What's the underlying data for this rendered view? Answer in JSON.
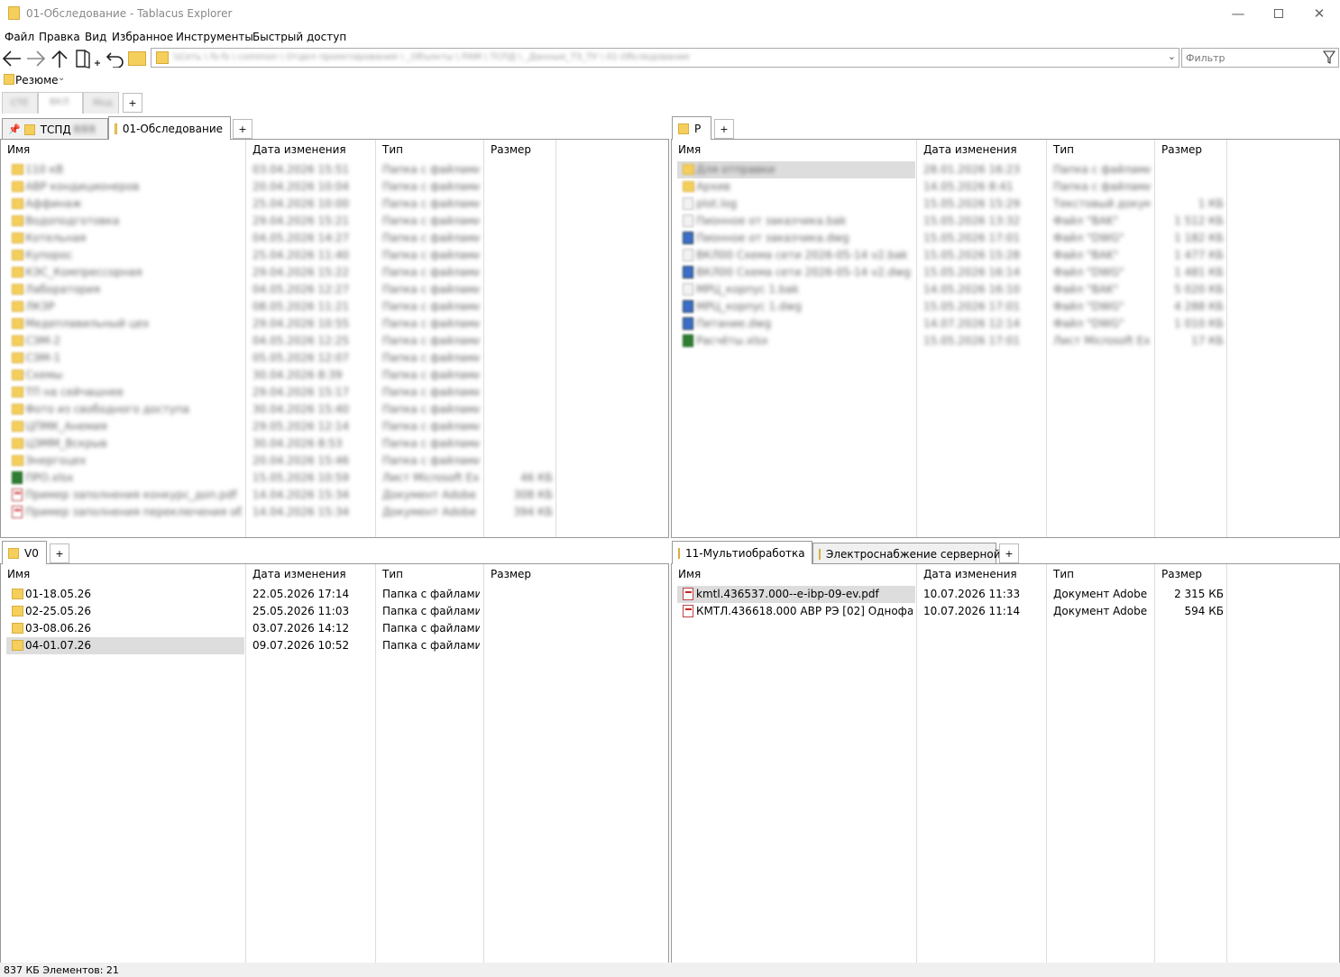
{
  "window": {
    "title": "01-Обследование - Tablacus Explorer"
  },
  "menu": [
    "Файл",
    "Правка",
    "Вид",
    "Избранное",
    "Инструменты",
    "Быстрый доступ"
  ],
  "address": {
    "path": "\\\\Сеть \\ fs-fs \\ common \\ Отдел проектирования \\ _Объекты \\ РАМ \\ ТСПД \\ _Данные_ТЗ_ТУ \\ 01-Обследование"
  },
  "filter": {
    "placeholder": "Фильтр"
  },
  "favorites": {
    "label": "Резюме"
  },
  "group_tabs": [
    "СТЕ",
    "ВКЛ",
    "Мод"
  ],
  "columns": {
    "name": "Имя",
    "date": "Дата изменения",
    "type": "Тип",
    "size": "Размер"
  },
  "panes": {
    "top_left": {
      "tabs": [
        "ТСПД",
        "01-Обследование"
      ],
      "tab_blur_suffix": "ЯЯЯ",
      "rows": [
        {
          "name": "110 кВ",
          "date": "03.04.2026 15:51",
          "type": "Папка с файлами",
          "size": "",
          "icon": "folder"
        },
        {
          "name": "АВР кондиционеров",
          "date": "20.04.2026 10:04",
          "type": "Папка с файлами",
          "size": "",
          "icon": "folder"
        },
        {
          "name": "Аффинаж",
          "date": "25.04.2026 10:00",
          "type": "Папка с файлами",
          "size": "",
          "icon": "folder"
        },
        {
          "name": "Водоподготовка",
          "date": "29.04.2026 15:21",
          "type": "Папка с файлами",
          "size": "",
          "icon": "folder"
        },
        {
          "name": "Котельная",
          "date": "04.05.2026 14:27",
          "type": "Папка с файлами",
          "size": "",
          "icon": "folder"
        },
        {
          "name": "Купорос",
          "date": "25.04.2026 11:40",
          "type": "Папка с файлами",
          "size": "",
          "icon": "folder"
        },
        {
          "name": "КЭС_Компрессорная",
          "date": "29.04.2026 15:22",
          "type": "Папка с файлами",
          "size": "",
          "icon": "folder"
        },
        {
          "name": "Лаборатория",
          "date": "04.05.2026 12:27",
          "type": "Папка с файлами",
          "size": "",
          "icon": "folder"
        },
        {
          "name": "ЛКЗР",
          "date": "08.05.2026 11:21",
          "type": "Папка с файлами",
          "size": "",
          "icon": "folder"
        },
        {
          "name": "Медеплавильный цех",
          "date": "29.04.2026 10:55",
          "type": "Папка с файлами",
          "size": "",
          "icon": "folder"
        },
        {
          "name": "СЭМ-2",
          "date": "04.05.2026 12:25",
          "type": "Папка с файлами",
          "size": "",
          "icon": "folder"
        },
        {
          "name": "СЭМ-1",
          "date": "05.05.2026 12:07",
          "type": "Папка с файлами",
          "size": "",
          "icon": "folder"
        },
        {
          "name": "Схемы",
          "date": "30.04.2026 8:39",
          "type": "Папка с файлами",
          "size": "",
          "icon": "folder"
        },
        {
          "name": "ТП на сейчашнее",
          "date": "29.04.2026 15:17",
          "type": "Папка с файлами",
          "size": "",
          "icon": "folder"
        },
        {
          "name": "Фото из свободного доступа",
          "date": "30.04.2026 15:40",
          "type": "Папка с файлами",
          "size": "",
          "icon": "folder"
        },
        {
          "name": "ЦПМК_Анемия",
          "date": "29.05.2026 12:14",
          "type": "Папка с файлами",
          "size": "",
          "icon": "folder"
        },
        {
          "name": "ЦЭММ_Вскрыв",
          "date": "30.04.2026 8:53",
          "type": "Папка с файлами",
          "size": "",
          "icon": "folder"
        },
        {
          "name": "Энергоцех",
          "date": "20.04.2026 15:46",
          "type": "Папка с файлами",
          "size": "",
          "icon": "folder"
        },
        {
          "name": "ПРО.xlsx",
          "date": "15.05.2026 10:59",
          "type": "Лист Microsoft Ex...",
          "size": "46 КБ",
          "icon": "xls"
        },
        {
          "name": "Пример заполнения конкурс_доп.pdf",
          "date": "14.04.2026 15:34",
          "type": "Документ Adobe ...",
          "size": "308 КБ",
          "icon": "pdf"
        },
        {
          "name": "Пример заполнения переключения обор...",
          "date": "14.04.2026 15:34",
          "type": "Документ Adobe ...",
          "size": "394 КБ",
          "icon": "pdf"
        }
      ]
    },
    "top_right": {
      "tabs": [
        "Р"
      ],
      "rows": [
        {
          "name": "Для отправки",
          "date": "28.01.2026 16:23",
          "type": "Папка с файлами",
          "size": "",
          "icon": "folder",
          "selected": true
        },
        {
          "name": "Архив",
          "date": "14.05.2026 8:41",
          "type": "Папка с файлами",
          "size": "",
          "icon": "folder"
        },
        {
          "name": "plot.log",
          "date": "15.05.2026 15:29",
          "type": "Текстовый докум...",
          "size": "1 КБ",
          "icon": "txt"
        },
        {
          "name": "Пионное от заказчика.bak",
          "date": "15.05.2026 13:32",
          "type": "Файл \"BAK\"",
          "size": "1 512 КБ",
          "icon": "txt"
        },
        {
          "name": "Пионное от заказчика.dwg",
          "date": "15.05.2026 17:01",
          "type": "Файл \"DWG\"",
          "size": "1 182 КБ",
          "icon": "dwg"
        },
        {
          "name": "ВКЛ00 Схема сети 2026-05-14 v2.bak",
          "date": "15.05.2026 15:28",
          "type": "Файл \"BAK\"",
          "size": "1 477 КБ",
          "icon": "txt"
        },
        {
          "name": "ВКЛ00 Схема сети 2026-05-14 v2.dwg",
          "date": "15.05.2026 16:14",
          "type": "Файл \"DWG\"",
          "size": "1 481 КБ",
          "icon": "dwg"
        },
        {
          "name": "МРЦ_корпус 1.bak",
          "date": "14.05.2026 16:10",
          "type": "Файл \"BAK\"",
          "size": "5 020 КБ",
          "icon": "txt"
        },
        {
          "name": "МРЦ_корпус 1.dwg",
          "date": "15.05.2026 17:01",
          "type": "Файл \"DWG\"",
          "size": "4 288 КБ",
          "icon": "dwg"
        },
        {
          "name": "Питание.dwg",
          "date": "14.07.2026 12:14",
          "type": "Файл \"DWG\"",
          "size": "1 010 КБ",
          "icon": "dwg"
        },
        {
          "name": "Расчёты.xlsx",
          "date": "15.05.2026 17:01",
          "type": "Лист Microsoft Ex...",
          "size": "17 КБ",
          "icon": "xls"
        }
      ]
    },
    "bottom_left": {
      "tabs": [
        "V0"
      ],
      "rows": [
        {
          "name": "01-18.05.26",
          "date": "22.05.2026 17:14",
          "type": "Папка с файлами",
          "size": "",
          "icon": "folder"
        },
        {
          "name": "02-25.05.26",
          "date": "25.05.2026 11:03",
          "type": "Папка с файлами",
          "size": "",
          "icon": "folder"
        },
        {
          "name": "03-08.06.26",
          "date": "03.07.2026 14:12",
          "type": "Папка с файлами",
          "size": "",
          "icon": "folder"
        },
        {
          "name": "04-01.07.26",
          "date": "09.07.2026 10:52",
          "type": "Папка с файлами",
          "size": "",
          "icon": "folder",
          "selected": true
        }
      ]
    },
    "bottom_right": {
      "tabs": [
        "11-Мультиобработка",
        "Электроснабжение серверной"
      ],
      "rows": [
        {
          "name": "kmtl.436537.000--e-ibp-09-ev.pdf",
          "date": "10.07.2026 11:33",
          "type": "Документ Adobe ...",
          "size": "2 315 КБ",
          "icon": "pdf",
          "selected": true
        },
        {
          "name": "КМТЛ.436618.000 АВР РЭ [02] Однофазные...",
          "date": "10.07.2026 11:14",
          "type": "Документ Adobe ...",
          "size": "594 КБ",
          "icon": "pdf"
        }
      ]
    }
  },
  "status": {
    "text": "837 КБ Элементов: 21"
  }
}
